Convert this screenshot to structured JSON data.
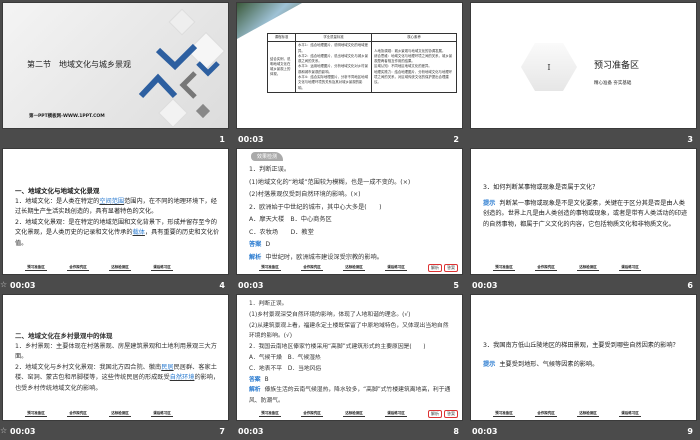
{
  "slides": [
    {
      "number": "1",
      "time": "",
      "title": "第二节　地域文化与城乡景观",
      "watermark": "第一PPT模板网-WWW.1PPT.COM"
    },
    {
      "number": "2",
      "time": "00:03",
      "table": {
        "headers": [
          "课程标准",
          "学业质量标准",
          "核心素养"
        ],
        "standard": "结合实例，说明地域文化在城乡景观上的体现。",
        "quality": [
          "水平1：结合地理图片，说明地域文化的地域差异。",
          "水平2：结合地理图片，说出地域文化与城乡景观之间的关系。",
          "水平3：运用地理图片，分析地域文化对乡村景观和城市景观的影响。",
          "水平4：结合实际地理图片，分析不同地区地域文化与地理环境的关系及其对城乡景观的影响。"
        ],
        "literacy": [
          "人地协调观：城乡景观与地域文化的协调发展。",
          "综合思维：地域文化与地理环境之间的关系，城乡景观是两者相互作用的结果。",
          "区域认知：不同地区地域文化的差异。",
          "地理实践力：结合地理图片，分析地域文化与地理环境之间的关系，对区域传统文化的保护提出合理建议。"
        ]
      }
    },
    {
      "number": "3",
      "time": "",
      "hex_numeral": "I",
      "title": "预习准备区",
      "subtitle": "精心准备 夯实基础"
    },
    {
      "number": "4",
      "time": "00:03",
      "heading": "一、地域文化与地域文化景观",
      "p1a": "1．地域文化：是人类在特定的",
      "p1blank": "空间范围",
      "p1b": "范围内，在不同的地理环境下，经过长期生产生活实践创造的，具有显著特色的文化。",
      "p2a": "2．地域文化景观：是在特定的地域范围和文化背景下，形成并留存至今的文化景观，是人类历史的记录和文化传承的",
      "p2blank": "载体",
      "p2b": "，具有重要的历史和文化价值。"
    },
    {
      "number": "5",
      "time": "00:03",
      "tag": "效果检测",
      "lines": [
        "1．判断正误。",
        "(1)地域文化的“地域”范围较为模糊，也是一成不变的。(×)",
        "(2)村落景观仅受到自然环境的影响。(×)",
        "2．欧洲始于中世纪的城市，其中心大多是(　　)",
        "A．摩天大楼　B．中心商务区",
        "C．农牧场　　D．教堂"
      ],
      "answer_label": "答案",
      "answer": "D",
      "analysis_label": "解析",
      "analysis": "中世纪时，欧洲城市建设深受宗教的影响。"
    },
    {
      "number": "6",
      "time": "00:03",
      "question": "3．如何判断某事物或现象是否属于文化？",
      "hint_label": "提示",
      "hint": "判断某一事物或现象是不是文化要素，关键在于区分其是否是由人类创造的。世界上凡是由人类创造的事物或现象，或者是带有人类活动的印迹的自然事物，都属于广义文化的内容，它包括物质文化和非物质文化。"
    },
    {
      "number": "7",
      "time": "00:03",
      "heading": "二、地域文化在乡村景观中的体现",
      "p1": "1．乡村景观：主要体现在村落景观、房屋建筑景观和土地利用景观三大方面。",
      "p2a": "2．地域文化与乡村文化景观：我国北方四合院、徽南",
      "p2blank": "民居",
      "p2b": "民居群、客家土楼、窑洞、蒙古包和吊脚楼等，这些传统民居的形成既受",
      "p2blank2": "自然环境",
      "p2c": "的影响，也受乡村传统地域文化的影响。"
    },
    {
      "number": "8",
      "time": "00:03",
      "lines": [
        "1．判断正误。",
        "(1)乡村景观深受自然环境的影响，体现了人地和谐的理念。(√)",
        "(2)从建筑景观上看，福建永定土楼既保留了中原地域特色，又体现出当地自然环境的影响。(√)",
        "2．我国云南地区傣家竹楼采用“高脚”式建筑形式的主要原因是(　　)",
        "A．气候干燥　B．气候湿热",
        "C．地表不平　D．当地风俗"
      ],
      "answer_label": "答案",
      "answer": "B",
      "analysis_label": "解析",
      "analysis": "傣族生活的云南气候湿热，降水较多，“高脚”式竹楼建筑离地高，利于通风、防潮气。"
    },
    {
      "number": "9",
      "time": "00:03",
      "question": "3．我国南方低山丘陵地区的梯田景观，主要受到哪些自然因素的影响？",
      "hint_label": "提示",
      "hint": "主要受到地形、气候等因素的影响。"
    }
  ],
  "nav_buttons": [
    "预习准备区",
    "合作探究区",
    "达标检测区",
    "课后练习区"
  ],
  "slide_buttons": [
    "解析",
    "答案"
  ],
  "colors": {
    "background": "#4b4b4b",
    "accent_blue": "#2a7bd0",
    "logo_blue": "#2d5fa0"
  }
}
